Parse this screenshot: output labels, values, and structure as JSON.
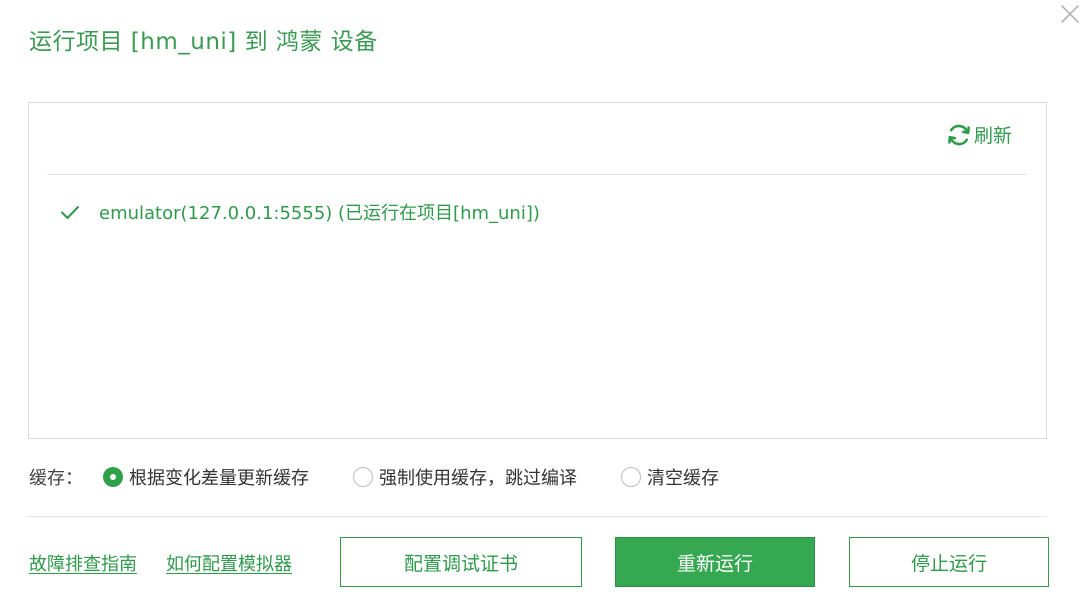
{
  "dialog": {
    "title": "运行项目 [hm_uni] 到 鸿蒙 设备"
  },
  "device_panel": {
    "refresh_label": "刷新",
    "devices": [
      {
        "label": "emulator(127.0.0.1:5555) (已运行在项目[hm_uni])",
        "selected": true
      }
    ]
  },
  "cache": {
    "label": "缓存：",
    "options": [
      {
        "label": "根据变化差量更新缓存",
        "selected": true
      },
      {
        "label": "强制使用缓存，跳过编译",
        "selected": false
      },
      {
        "label": "清空缓存",
        "selected": false
      }
    ]
  },
  "footer": {
    "links": [
      "故障排查指南",
      "如何配置模拟器"
    ],
    "configure_cert_label": "配置调试证书",
    "rerun_label": "重新运行",
    "stop_label": "停止运行"
  },
  "colors": {
    "accent": "#36a852",
    "text_green": "#2f9a4b"
  }
}
